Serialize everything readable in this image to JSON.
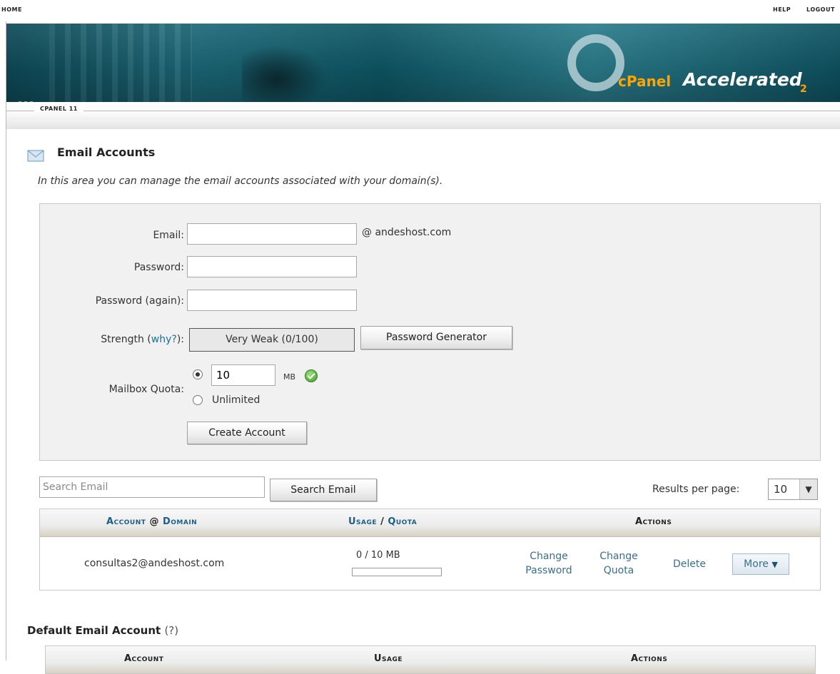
{
  "nav": {
    "home": "HOME",
    "help": "HELP",
    "logout": "LOGOUT"
  },
  "brand": {
    "name": "cPanel",
    "tagline": "Accelerated",
    "version": "2"
  },
  "breadcrumb": {
    "tab": "CPANEL 11"
  },
  "page": {
    "title": "Email Accounts",
    "description": "In this area you can manage the email accounts associated with your domain(s)."
  },
  "form": {
    "email_label": "Email:",
    "email_value": "",
    "domain_suffix": "@ andeshost.com",
    "password_label": "Password:",
    "password_again_label": "Password (again):",
    "strength_label_prefix": "Strength (",
    "strength_why": "why?",
    "strength_label_suffix": "):",
    "strength_value": "Very Weak (0/100)",
    "password_generator_button": "Password Generator",
    "quota_label": "Mailbox Quota:",
    "quota_value": "10",
    "quota_unit": "MB",
    "quota_unlimited": "Unlimited",
    "quota_selected": "limited",
    "create_button": "Create Account"
  },
  "search": {
    "placeholder": "Search Email",
    "button": "Search Email",
    "results_per_page_label": "Results per page:",
    "results_per_page_value": "10"
  },
  "table": {
    "headers": {
      "account": "Account",
      "at": "@",
      "domain": "Domain",
      "usage": "Usage",
      "slash": "/",
      "quota": "Quota",
      "actions": "Actions"
    },
    "rows": [
      {
        "account": "consultas2@andeshost.com",
        "usage": "0 / 10 MB",
        "usage_fraction": 0,
        "change_password_line1": "Change",
        "change_password_line2": "Password",
        "change_quota_line1": "Change",
        "change_quota_line2": "Quota",
        "delete": "Delete",
        "more": "More"
      }
    ]
  },
  "default_account": {
    "title": "Default Email Account",
    "help": "(?)",
    "headers": {
      "account": "Account",
      "usage": "Usage",
      "actions": "Actions"
    }
  },
  "colors": {
    "link": "#1a6fa0",
    "banner": "#0e5765",
    "brand_orange": "#ffa400",
    "panel_bg": "#f1f1f1"
  }
}
